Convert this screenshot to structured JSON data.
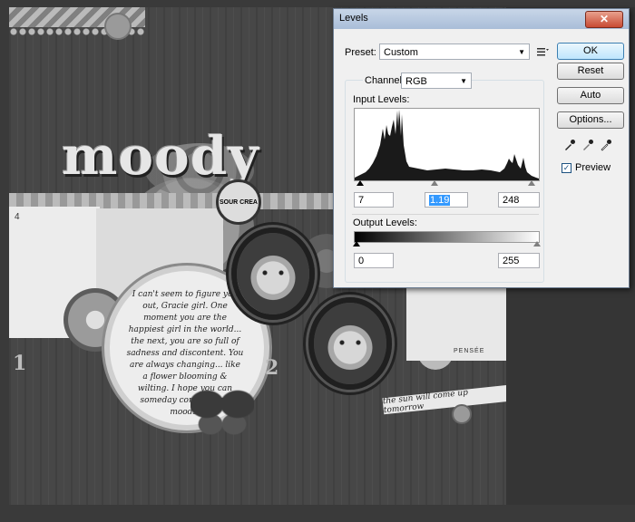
{
  "artwork": {
    "title_word": "moody",
    "card_number": "4",
    "journal_text": "I can't seem to figure you out, Gracie girl. One moment you are the happiest girl in the world... the next, you are so full of sadness and discontent. You are always changing... like a flower blooming & wilting. I hope you can someday control your moods!",
    "banner_text": "the sun will come up tomorrow",
    "card_caption": "PENSÉE",
    "badge_text": "SOUR CREA",
    "big_numbers": [
      "1",
      "2"
    ]
  },
  "dialog": {
    "title": "Levels",
    "close_label": "✕",
    "preset": {
      "label": "Preset:",
      "value": "Custom"
    },
    "channel": {
      "label": "Channel:",
      "value": "RGB"
    },
    "input_levels": {
      "label": "Input Levels:",
      "black": "7",
      "gamma": "1.19",
      "white": "248"
    },
    "output_levels": {
      "label": "Output Levels:",
      "black": "0",
      "white": "255"
    },
    "buttons": {
      "ok": "OK",
      "cancel": "Reset",
      "auto": "Auto",
      "options": "Options..."
    },
    "preview": {
      "label": "Preview",
      "checked": true
    },
    "icons": [
      "preset-options-icon",
      "black-eyedropper-icon",
      "gray-eyedropper-icon",
      "white-eyedropper-icon"
    ]
  }
}
